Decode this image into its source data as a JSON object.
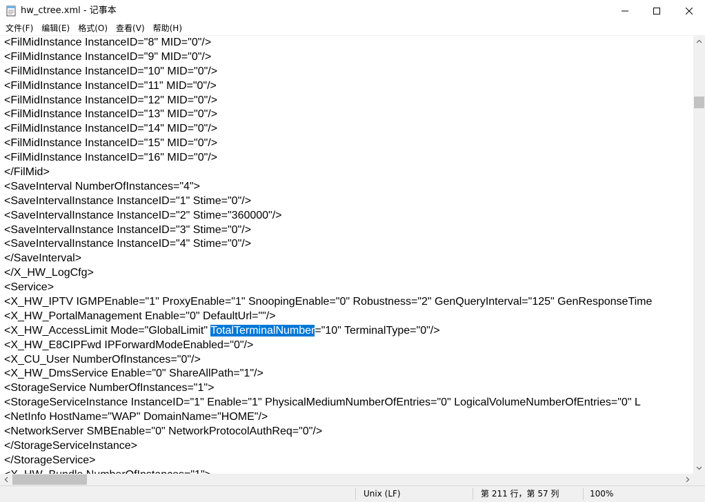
{
  "window": {
    "title": "hw_ctree.xml - 记事本",
    "icon": "notepad-icon",
    "minimize_icon": "minimize-icon",
    "maximize_icon": "maximize-icon",
    "close_icon": "close-icon"
  },
  "menu": {
    "items": [
      {
        "label": "文件(F)"
      },
      {
        "label": "编辑(E)"
      },
      {
        "label": "格式(O)"
      },
      {
        "label": "查看(V)"
      },
      {
        "label": "帮助(H)"
      }
    ]
  },
  "editor": {
    "lines": [
      "<FilMidInstance InstanceID=\"8\" MID=\"0\"/>",
      "<FilMidInstance InstanceID=\"9\" MID=\"0\"/>",
      "<FilMidInstance InstanceID=\"10\" MID=\"0\"/>",
      "<FilMidInstance InstanceID=\"11\" MID=\"0\"/>",
      "<FilMidInstance InstanceID=\"12\" MID=\"0\"/>",
      "<FilMidInstance InstanceID=\"13\" MID=\"0\"/>",
      "<FilMidInstance InstanceID=\"14\" MID=\"0\"/>",
      "<FilMidInstance InstanceID=\"15\" MID=\"0\"/>",
      "<FilMidInstance InstanceID=\"16\" MID=\"0\"/>",
      "</FilMid>",
      "<SaveInterval NumberOfInstances=\"4\">",
      "<SaveIntervalInstance InstanceID=\"1\" Stime=\"0\"/>",
      "<SaveIntervalInstance InstanceID=\"2\" Stime=\"360000\"/>",
      "<SaveIntervalInstance InstanceID=\"3\" Stime=\"0\"/>",
      "<SaveIntervalInstance InstanceID=\"4\" Stime=\"0\"/>",
      "</SaveInterval>",
      "</X_HW_LogCfg>",
      "<Service>",
      "<X_HW_IPTV IGMPEnable=\"1\" ProxyEnable=\"1\" SnoopingEnable=\"0\" Robustness=\"2\" GenQueryInterval=\"125\" GenResponseTime",
      "<X_HW_PortalManagement Enable=\"0\" DefaultUrl=\"\"/>",
      "<X_HW_AccessLimit Mode=\"GlobalLimit\" ",
      "<X_HW_E8CIPFwd IPForwardModeEnabled=\"0\"/>",
      "<X_CU_User NumberOfInstances=\"0\"/>",
      "<X_HW_DmsService Enable=\"0\" ShareAllPath=\"1\"/>",
      "<StorageService NumberOfInstances=\"1\">",
      "<StorageServiceInstance InstanceID=\"1\" Enable=\"1\" PhysicalMediumNumberOfEntries=\"0\" LogicalVolumeNumberOfEntries=\"0\" L",
      "<NetInfo HostName=\"WAP\" DomainName=\"HOME\"/>",
      "<NetworkServer SMBEnable=\"0\" NetworkProtocolAuthReq=\"0\"/>",
      "</StorageServiceInstance>",
      "</StorageService>",
      "<X_HW_Bundle NumberOfInstances=\"1\">"
    ],
    "selection_line": {
      "before": "<X_HW_AccessLimit Mode=\"GlobalLimit\" ",
      "selected": "TotalTerminalNumber",
      "after": "=\"10\" TerminalType=\"0\"/>"
    },
    "selection_color": "#0078d7"
  },
  "statusbar": {
    "encoding_line_ending": "Unix (LF)",
    "position": "第 211 行，第 57 列",
    "zoom": "100%"
  }
}
